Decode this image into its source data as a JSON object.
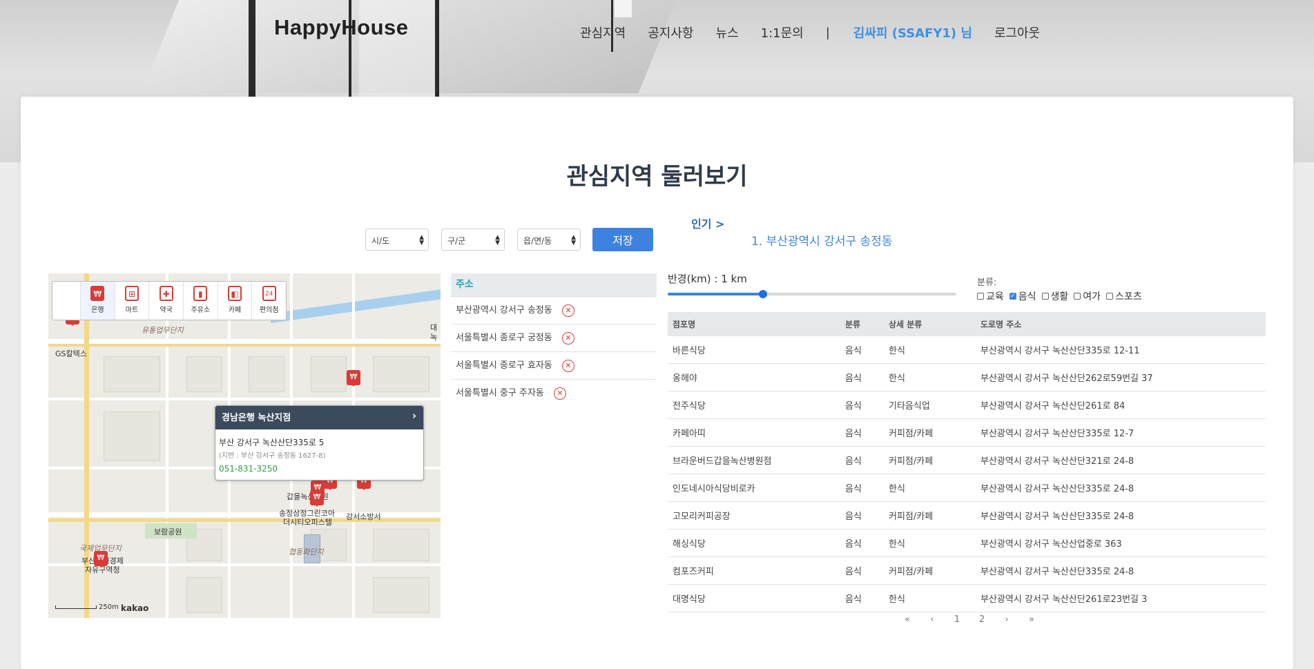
{
  "header": {
    "logo": "HappyHouse",
    "nav": [
      "관심지역",
      "공지사항",
      "뉴스",
      "1:1문의"
    ],
    "separator": "|",
    "user": "김싸피 (SSAFY1) 님",
    "logout": "로그아웃"
  },
  "page_title": "관심지역 둘러보기",
  "selects": {
    "sido": "시/도",
    "gugun": "구/군",
    "dong": "읍/면/동"
  },
  "save_label": "저장",
  "popular": {
    "label": "인기 >",
    "items": [
      "1. 부산광역시 강서구 송정동"
    ]
  },
  "map": {
    "categories": [
      {
        "label": "은행",
        "icon": "bank-icon",
        "glyph": "₩"
      },
      {
        "label": "마트",
        "icon": "cart-icon",
        "glyph": "🛒"
      },
      {
        "label": "약국",
        "icon": "pharmacy-icon",
        "glyph": "✚"
      },
      {
        "label": "주유소",
        "icon": "gas-icon",
        "glyph": "⛽"
      },
      {
        "label": "카페",
        "icon": "cafe-icon",
        "glyph": "☕"
      },
      {
        "label": "편의점",
        "icon": "store-icon",
        "glyph": "24"
      }
    ],
    "labels": {
      "gs": "GS칼텍스",
      "complex1": "유통업무단지",
      "park": "보람공원",
      "complex2": "협동화단지",
      "complex3": "국제업무단지",
      "hall_a": "부산진해경제",
      "hall_b": "자유구역청",
      "songjeong_a": "송정삼정그린코아",
      "songjeong_b": "더시티오피스텔",
      "fire": "강서소방서",
      "gangseo": "갑을녹산병원",
      "edge_a": "대",
      "edge_b": "녹"
    },
    "info": {
      "name": "경남은행 녹산지점",
      "address": "부산 강서구 녹산산단335로 5",
      "jibun": "(지번 : 부산 강서구 송정동 1627-8)",
      "tel": "051-831-3250"
    },
    "scale": "250m",
    "brand": "kakao"
  },
  "saved": {
    "header": "주소",
    "items": [
      "부산광역시 강서구 송정동",
      "서울특별시 종로구 궁정동",
      "서울특별시 종로구 효자동",
      "서울특별시 중구 주자동"
    ]
  },
  "radius": {
    "label": "반경(km) : 1 km",
    "value_fraction": 0.33
  },
  "filters": {
    "label": "분류:",
    "items": [
      {
        "label": "교육",
        "checked": false
      },
      {
        "label": "음식",
        "checked": true
      },
      {
        "label": "생활",
        "checked": false
      },
      {
        "label": "여가",
        "checked": false
      },
      {
        "label": "스포츠",
        "checked": false
      }
    ]
  },
  "stores": {
    "columns": [
      "점포명",
      "분류",
      "상세 분류",
      "도로명 주소"
    ],
    "rows": [
      [
        "바른식당",
        "음식",
        "한식",
        "부산광역시 강서구 녹산산단335로 12-11"
      ],
      [
        "옹헤야",
        "음식",
        "한식",
        "부산광역시 강서구 녹산산단262로59번길 37"
      ],
      [
        "전주식당",
        "음식",
        "기타음식업",
        "부산광역시 강서구 녹산산단261로 84"
      ],
      [
        "카페아띠",
        "음식",
        "커피점/카페",
        "부산광역시 강서구 녹산산단335로 12-7"
      ],
      [
        "브라운버드갑을녹산병원점",
        "음식",
        "커피점/카페",
        "부산광역시 강서구 녹산산단321로 24-8"
      ],
      [
        "인도네시아식당비로카",
        "음식",
        "한식",
        "부산광역시 강서구 녹산산단335로 24-8"
      ],
      [
        "고모리커피공장",
        "음식",
        "커피점/카페",
        "부산광역시 강서구 녹산산단335로 24-8"
      ],
      [
        "해싱식당",
        "음식",
        "한식",
        "부산광역시 강서구 녹산산업중로 363"
      ],
      [
        "컴포즈커피",
        "음식",
        "커피점/카페",
        "부산광역시 강서구 녹산산단335로 24-8"
      ],
      [
        "대명식당",
        "음식",
        "한식",
        "부산광역시 강서구 녹산산단261로23번길 3"
      ]
    ]
  },
  "pager": [
    "«",
    "‹",
    "1",
    "2",
    "›",
    "»"
  ]
}
